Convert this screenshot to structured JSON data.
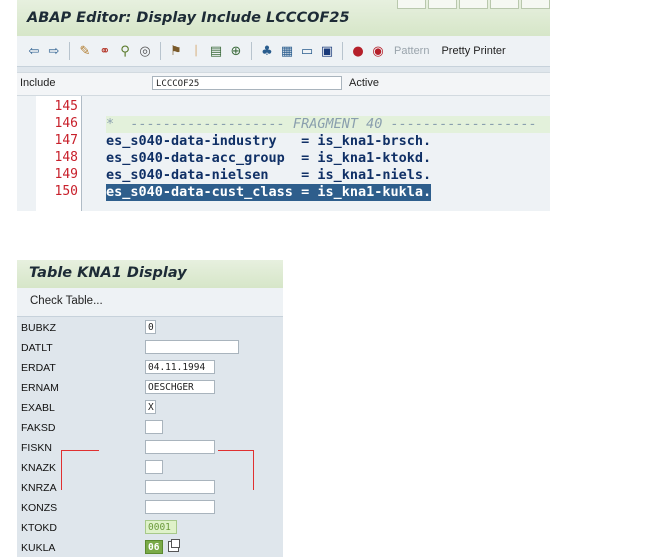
{
  "editor": {
    "title": "ABAP Editor: Display Include LCCCOF25",
    "toolbar": {
      "icons": [
        "arrow-left-icon",
        "arrow-right-icon",
        "pencil-glasses-icon",
        "where-used-icon",
        "object-list-icon",
        "activate-icon",
        "hierarchy-icon",
        "info-icon",
        "stack-icon",
        "nav-window-icon",
        "layout-icon",
        "tree-icon",
        "monitor-icon",
        "information-icon",
        "breakpoint-icon",
        "session-breakpoint-icon"
      ],
      "pattern_label": "Pattern",
      "pretty_printer_label": "Pretty Printer"
    },
    "include_label": "Include",
    "include_value": "LCCCOF25",
    "status": "Active",
    "code": [
      {
        "ln": "145",
        "text": "",
        "kind": "plain"
      },
      {
        "ln": "146",
        "text": "*  ------------------- FRAGMENT 40 ------------------",
        "kind": "comment"
      },
      {
        "ln": "147",
        "text": "es_s040-data-industry   = is_kna1-brsch.",
        "kind": "plain"
      },
      {
        "ln": "148",
        "text": "es_s040-data-acc_group  = is_kna1-ktokd.",
        "kind": "plain"
      },
      {
        "ln": "149",
        "text": "es_s040-data-nielsen    = is_kna1-niels.",
        "kind": "plain"
      },
      {
        "ln": "150",
        "text": "es_s040-data-cust_class = is_kna1-kukla.",
        "kind": "selected"
      }
    ]
  },
  "table_display": {
    "title": "Table KNA1 Display",
    "check_table_label": "Check Table...",
    "fields": [
      {
        "name": "BUBKZ",
        "value": "0",
        "style": "plain"
      },
      {
        "name": "DATLT",
        "value": "",
        "style": "plain"
      },
      {
        "name": "ERDAT",
        "value": "04.11.1994",
        "style": "plain"
      },
      {
        "name": "ERNAM",
        "value": "OESCHGER",
        "style": "plain"
      },
      {
        "name": "EXABL",
        "value": "X",
        "style": "plain"
      },
      {
        "name": "FAKSD",
        "value": "",
        "style": "plain"
      },
      {
        "name": "FISKN",
        "value": "",
        "style": "plain"
      },
      {
        "name": "KNAZK",
        "value": "",
        "style": "plain"
      },
      {
        "name": "KNRZA",
        "value": "",
        "style": "plain"
      },
      {
        "name": "KONZS",
        "value": "",
        "style": "plain"
      },
      {
        "name": "KTOKD",
        "value": "0001",
        "style": "green"
      },
      {
        "name": "KUKLA",
        "value": "06",
        "style": "greensel"
      }
    ]
  },
  "colors": {
    "title_bar": "#dbe8cf",
    "line_number": "#c8202b",
    "code_text": "#103066",
    "selection": "#2e5e8c",
    "highlight_green": "#7aaa48",
    "annotation_red": "#e03030"
  }
}
